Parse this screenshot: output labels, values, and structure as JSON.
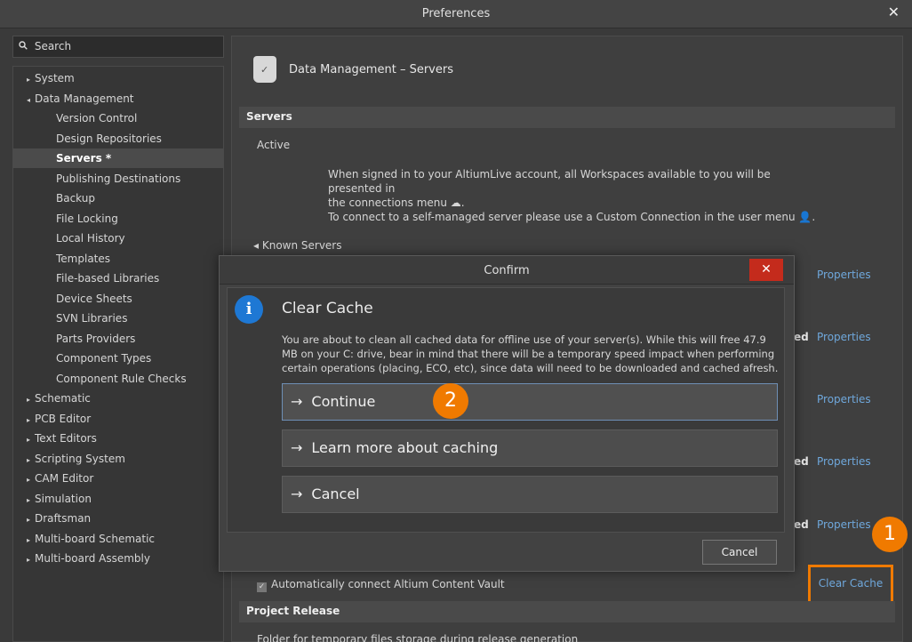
{
  "window": {
    "title": "Preferences",
    "close_symbol": "✕"
  },
  "search": {
    "placeholder": "Search",
    "icon": "search-icon"
  },
  "tree": [
    {
      "label": "System",
      "level": 0,
      "arrow": "▸"
    },
    {
      "label": "Data Management",
      "level": 0,
      "arrow": "◂"
    },
    {
      "label": "Version Control",
      "level": 1
    },
    {
      "label": "Design Repositories",
      "level": 1
    },
    {
      "label": "Servers *",
      "level": 1,
      "selected": true
    },
    {
      "label": "Publishing Destinations",
      "level": 1
    },
    {
      "label": "Backup",
      "level": 1
    },
    {
      "label": "File Locking",
      "level": 1
    },
    {
      "label": "Local History",
      "level": 1
    },
    {
      "label": "Templates",
      "level": 1
    },
    {
      "label": "File-based Libraries",
      "level": 1
    },
    {
      "label": "Device Sheets",
      "level": 1
    },
    {
      "label": "SVN Libraries",
      "level": 1
    },
    {
      "label": "Parts Providers",
      "level": 1
    },
    {
      "label": "Component Types",
      "level": 1
    },
    {
      "label": "Component Rule Checks",
      "level": 1
    },
    {
      "label": "Schematic",
      "level": 0,
      "arrow": "▸"
    },
    {
      "label": "PCB Editor",
      "level": 0,
      "arrow": "▸"
    },
    {
      "label": "Text Editors",
      "level": 0,
      "arrow": "▸"
    },
    {
      "label": "Scripting System",
      "level": 0,
      "arrow": "▸"
    },
    {
      "label": "CAM Editor",
      "level": 0,
      "arrow": "▸"
    },
    {
      "label": "Simulation",
      "level": 0,
      "arrow": "▸"
    },
    {
      "label": "Draftsman",
      "level": 0,
      "arrow": "▸"
    },
    {
      "label": "Multi-board Schematic",
      "level": 0,
      "arrow": "▸"
    },
    {
      "label": "Multi-board Assembly",
      "level": 0,
      "arrow": "▸"
    }
  ],
  "main": {
    "page_title": "Data Management – Servers",
    "servers_header": "Servers",
    "active_label": "Active",
    "info_line1": "When signed in to your AltiumLive account, all Workspaces available to you will be presented in",
    "info_line2": "the connections menu ☁.",
    "info_line3": "To connect to a self-managed server please use a Custom Connection in the user menu 👤.",
    "known_servers": "◂ Known Servers",
    "properties_label": "Properties",
    "ed_label": "ed",
    "auto_connect_label": "Automatically connect Altium Content Vault",
    "clear_cache_label": "Clear Cache",
    "project_release_header": "Project Release",
    "footer_text": "Folder for temporary files storage during release generation"
  },
  "modal": {
    "title": "Confirm",
    "close_symbol": "✕",
    "heading": "Clear Cache",
    "description": "You are about to clean all cached data for offline use of your server(s). While this will free 47.9 MB on your C: drive, bear in mind that there will be a temporary speed impact when performing certain operations (placing, ECO, etc), since data will need to be downloaded and cached afresh.",
    "continue_label": "Continue",
    "learn_more_label": "Learn more about caching",
    "cancel_option_label": "Cancel",
    "cancel_button_label": "Cancel",
    "arrow": "→"
  },
  "badges": {
    "one": "1",
    "two": "2"
  },
  "colors": {
    "accent": "#f07a00",
    "link": "#6fa8dc",
    "info": "#1e78d4",
    "close_red": "#c42b1c"
  }
}
